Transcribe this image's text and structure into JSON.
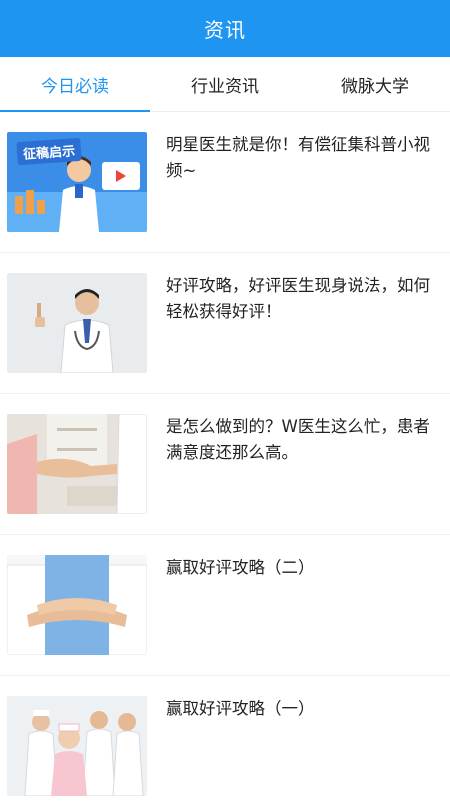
{
  "header": {
    "title": "资讯"
  },
  "tabs": [
    {
      "label": "今日必读",
      "active": true
    },
    {
      "label": "行业资讯",
      "active": false
    },
    {
      "label": "微脉大学",
      "active": false
    }
  ],
  "articles": [
    {
      "title": "明星医生就是你！有偿征集科普小视频~",
      "thumb_caption": "征稿启示",
      "thumb": "doctor-cartoon-banner"
    },
    {
      "title": "好评攻略，好评医生现身说法，如何轻松获得好评！",
      "thumb": "doctor-portrait"
    },
    {
      "title": "是怎么做到的？W医生这么忙，患者满意度还那么高。",
      "thumb": "handshake-photo"
    },
    {
      "title": "赢取好评攻略（二）",
      "thumb": "team-hands-photo"
    },
    {
      "title": "赢取好评攻略（一）",
      "thumb": "medical-team-photo"
    }
  ],
  "colors": {
    "accent": "#1f95f2",
    "text": "#222222"
  }
}
